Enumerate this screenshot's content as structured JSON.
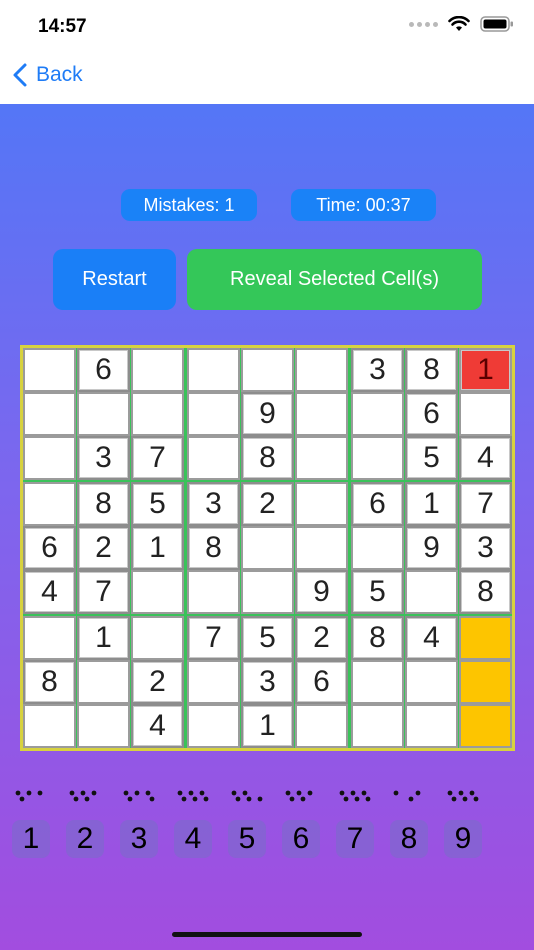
{
  "status": {
    "time": "14:57"
  },
  "nav": {
    "back_label": "Back"
  },
  "stats": {
    "mistakes": "Mistakes: 1",
    "time": "Time: 00:37"
  },
  "buttons": {
    "restart": "Restart",
    "reveal": "Reveal Selected Cell(s)"
  },
  "colors": {
    "accent_blue": "#1a82f7",
    "green": "#34c759",
    "error_red": "#ef3b36",
    "selected_yellow": "#fdc500"
  },
  "board": {
    "rows": [
      [
        "",
        "6",
        "",
        "",
        "",
        "",
        "3",
        "8",
        "1"
      ],
      [
        "",
        "",
        "",
        "",
        "9",
        "",
        "",
        "6",
        ""
      ],
      [
        "",
        "3",
        "7",
        "",
        "8",
        "",
        "",
        "5",
        "4"
      ],
      [
        "",
        "8",
        "5",
        "3",
        "2",
        "",
        "6",
        "1",
        "7"
      ],
      [
        "6",
        "2",
        "1",
        "8",
        "",
        "",
        "",
        "9",
        "3"
      ],
      [
        "4",
        "7",
        "",
        "",
        "",
        "9",
        "5",
        "",
        "8"
      ],
      [
        "",
        "1",
        "",
        "7",
        "5",
        "2",
        "8",
        "4",
        ""
      ],
      [
        "8",
        "",
        "2",
        "",
        "3",
        "6",
        "",
        "",
        ""
      ],
      [
        "",
        "",
        "4",
        "",
        "1",
        "",
        "",
        "",
        ""
      ]
    ],
    "error_cells": [
      [
        0,
        8
      ]
    ],
    "selected_cells": [
      [
        6,
        8
      ],
      [
        7,
        8
      ],
      [
        8,
        8
      ]
    ]
  },
  "number_pad": {
    "keys": [
      {
        "label": "1",
        "icon": "braille-1-icon"
      },
      {
        "label": "2",
        "icon": "braille-2-icon"
      },
      {
        "label": "3",
        "icon": "braille-3-icon"
      },
      {
        "label": "4",
        "icon": "braille-4-icon"
      },
      {
        "label": "5",
        "icon": "braille-5-icon"
      },
      {
        "label": "6",
        "icon": "braille-6-icon"
      },
      {
        "label": "7",
        "icon": "braille-7-icon"
      },
      {
        "label": "8",
        "icon": "braille-8-icon"
      },
      {
        "label": "9",
        "icon": "braille-9-icon"
      }
    ]
  }
}
